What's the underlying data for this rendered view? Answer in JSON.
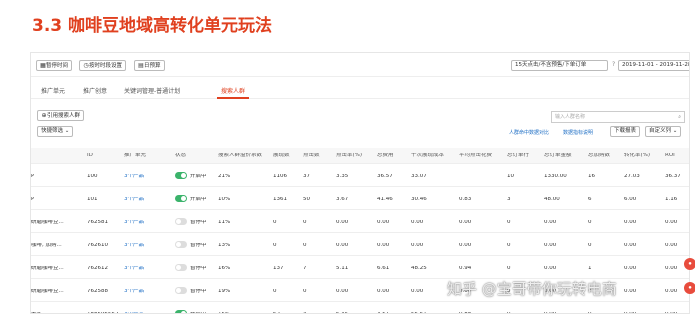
{
  "heading": "3.3 咖啡豆地域高转化单元玩法",
  "toolbar": {
    "pause_label": "暂停时间",
    "schedule_label": "按时时段设置",
    "budget_label": "日预算",
    "attribution_select": "15天点击/不含预售/下单订单",
    "date_start": "2019-11-01",
    "date_end": "2019-11-28"
  },
  "tabs": [
    {
      "label": "推广单元",
      "active": false
    },
    {
      "label": "推广创意",
      "active": false
    },
    {
      "label": "关键词管理-普通计划",
      "active": false
    },
    {
      "label": "搜索人群",
      "active": true
    }
  ],
  "actions": {
    "add_crowd_label": "引用搜索人群",
    "quick_filter_label": "快捷筛选",
    "search_placeholder": "输入人群名称",
    "crowd_compare_link": "人群命中数据对比",
    "data_explain_link": "数据指标说明",
    "download_label": "下载报表",
    "custom_cols_label": "自定义列"
  },
  "table": {
    "headers": [
      "ID",
      "推广单元",
      "状态",
      "搜索人群溢价系数",
      "展现数",
      "点击数",
      "点击率(%)",
      "总费用",
      "千次展现成本",
      "平均点击花费",
      "总订单行",
      "总订单金额",
      "总加购数",
      "转化率(%)",
      "ROI"
    ],
    "rows": [
      {
        "name": "P",
        "id": "100",
        "unit": "3个产品",
        "on": true,
        "status": "开启中",
        "premium": "21%",
        "cells": [
          "1106",
          "37",
          "3.35",
          "36.57",
          "33.07",
          "",
          "10",
          "1330.00",
          "16",
          "27.03",
          "36.37"
        ]
      },
      {
        "name": "P",
        "id": "101",
        "unit": "3个产品",
        "on": true,
        "status": "开启中",
        "premium": "10%",
        "cells": [
          "1361",
          "50",
          "3.67",
          "41.46",
          "30.46",
          "0.83",
          "3",
          "48.00",
          "6",
          "6.00",
          "1.16"
        ]
      },
      {
        "name": "研磨咖啡豆...",
        "id": "762581",
        "unit": "3个产品",
        "on": false,
        "status": "暂停中",
        "premium": "11%",
        "cells": [
          "0",
          "0",
          "0.00",
          "0.00",
          "0.00",
          "0.00",
          "0",
          "0.00",
          "0",
          "0.00",
          "0.00"
        ]
      },
      {
        "name": "咖啡, 加购...",
        "id": "762610",
        "unit": "3个产品",
        "on": false,
        "status": "暂停中",
        "premium": "13%",
        "cells": [
          "0",
          "0",
          "0.00",
          "0.00",
          "0.00",
          "0.00",
          "0",
          "0.00",
          "0",
          "0.00",
          "0.00"
        ]
      },
      {
        "name": "研磨咖啡豆...",
        "id": "762612",
        "unit": "3个产品",
        "on": false,
        "status": "暂停中",
        "premium": "16%",
        "cells": [
          "137",
          "7",
          "5.11",
          "6.61",
          "48.25",
          "0.94",
          "0",
          "0.00",
          "1",
          "0.00",
          "0.00"
        ]
      },
      {
        "name": "研磨咖啡豆...",
        "id": "762588",
        "unit": "3个产品",
        "on": false,
        "status": "暂停中",
        "premium": "19%",
        "cells": [
          "0",
          "0",
          "0.00",
          "0.00",
          "0.00",
          "0.00",
          "0",
          "0.00",
          "0",
          "0.00",
          "0.00"
        ]
      },
      {
        "name": "老客",
        "id": "188596562",
        "unit": "3个产品",
        "on": true,
        "status": "开启中",
        "premium": "15%",
        "cells": [
          "62",
          "4",
          "6.45",
          "3.51",
          "56.61",
          "0.88",
          "0",
          "0.00",
          "0",
          "0.00",
          "0.00"
        ]
      }
    ]
  },
  "watermark": "知乎 @宝哥带你玩转电商",
  "colors": {
    "accent": "#e0401f",
    "link": "#1f6fc5",
    "toggle_on": "#3bb36b"
  }
}
